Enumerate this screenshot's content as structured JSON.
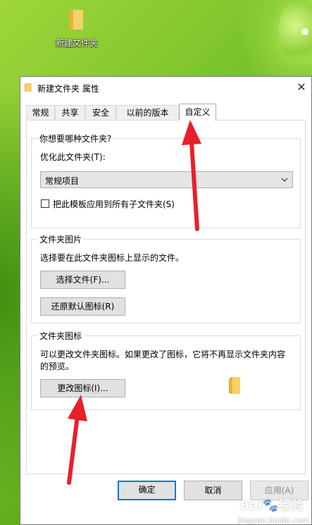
{
  "desktop": {
    "icon_label": "新建文件夹"
  },
  "window": {
    "title": "新建文件夹 属性",
    "close_glyph": "✕"
  },
  "tabs": [
    {
      "label": "常规"
    },
    {
      "label": "共享"
    },
    {
      "label": "安全"
    },
    {
      "label": "以前的版本"
    },
    {
      "label": "自定义",
      "active": true
    }
  ],
  "group_type": {
    "title": "你想要哪种文件夹?",
    "optimize_label": "优化此文件夹(T):",
    "combo_value": "常规项目",
    "apply_template_label": "把此模板应用到所有子文件夹(S)",
    "apply_template_checked": false
  },
  "group_pictures": {
    "title": "文件夹图片",
    "description": "选择要在此文件夹图标上显示的文件。",
    "choose_file_label": "选择文件(F)...",
    "restore_default_label": "还原默认图标(R)"
  },
  "group_icons": {
    "title": "文件夹图标",
    "description_line1": "可以更改文件夹图标。如果更改了图标，它将不再显示文件夹内容",
    "description_line2": "的预览。",
    "change_icon_label": "更改图标(I)..."
  },
  "footer": {
    "ok_label": "确定",
    "cancel_label": "取消",
    "apply_label": "应用(A)"
  },
  "watermark": {
    "logo": "Bai🐾经验",
    "text": "jingyan.baidu.com"
  },
  "colors": {
    "accent": "#0078d7",
    "annotation_arrow": "#e8202a",
    "folder_yellow": "#f3c14a"
  },
  "icons": [
    "folder-icon",
    "close-icon",
    "chevron-down-icon",
    "checkbox-icon",
    "annotation-arrow-icon"
  ]
}
